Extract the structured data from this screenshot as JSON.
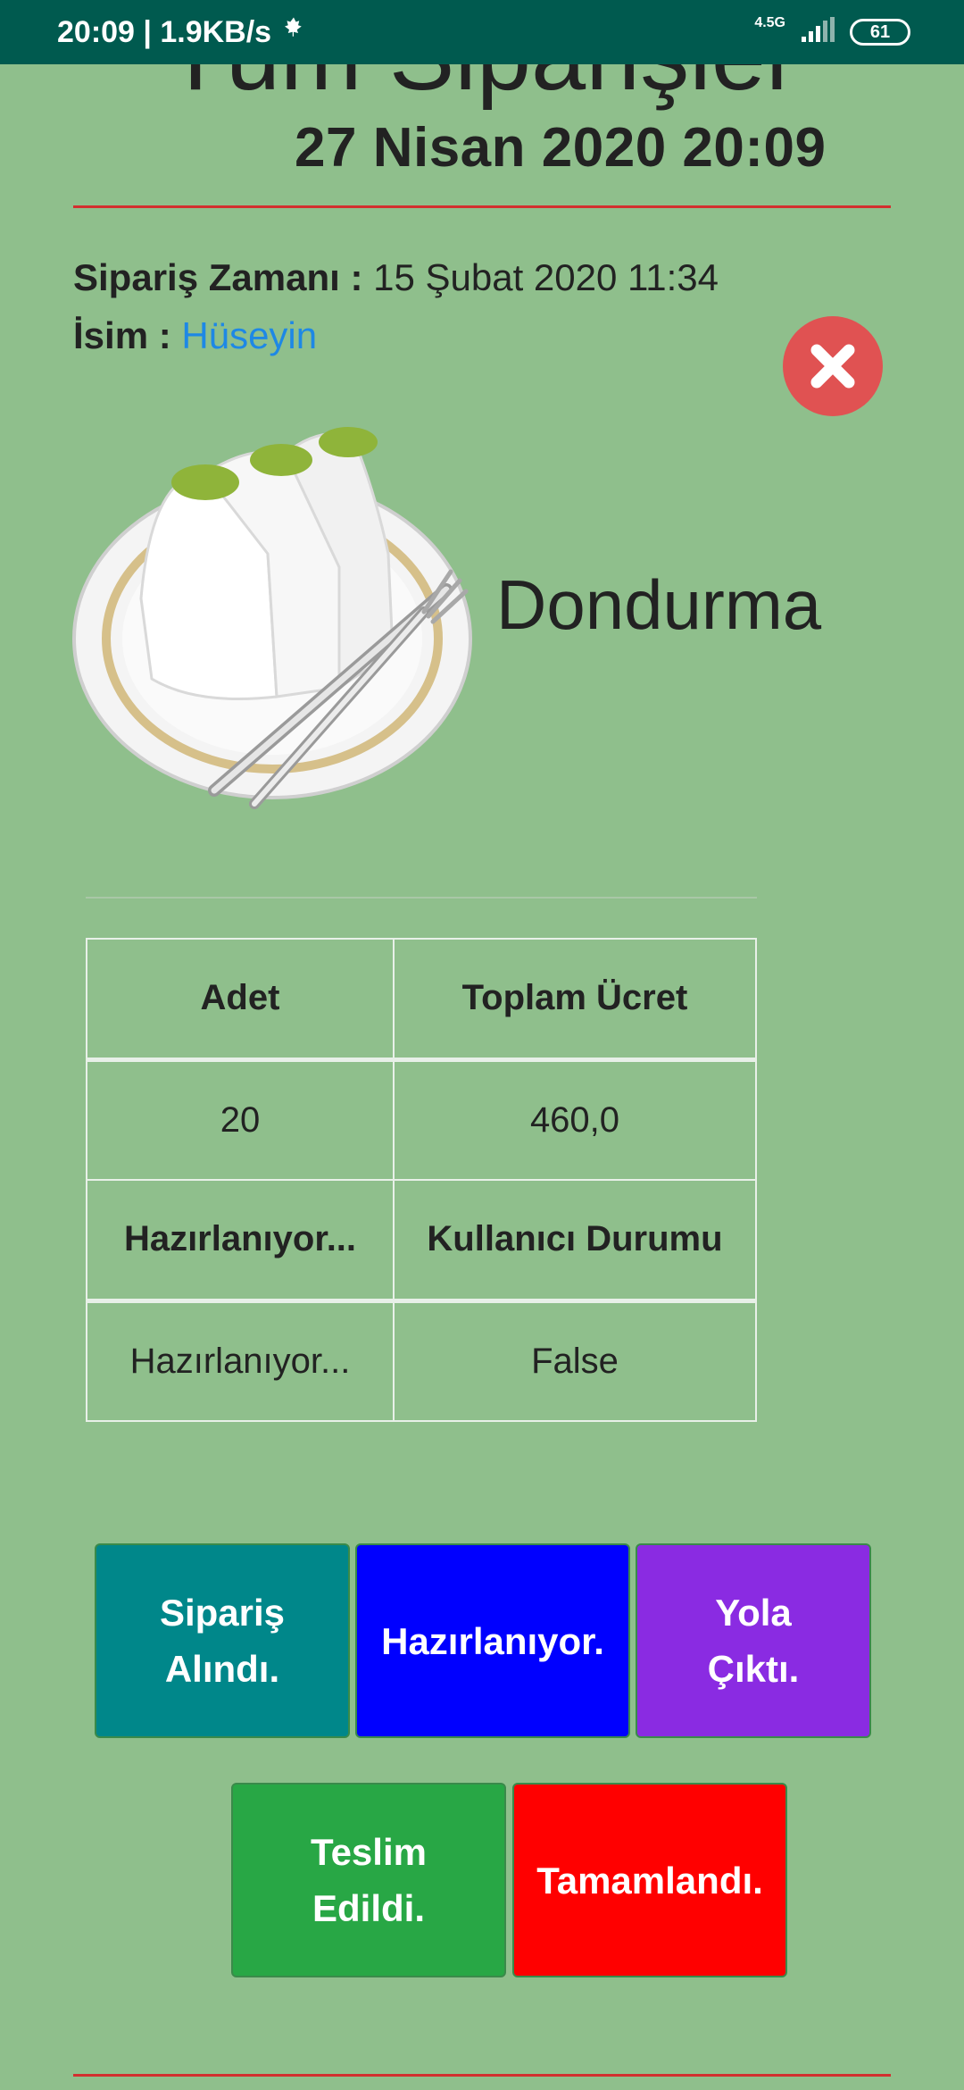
{
  "status_bar": {
    "time_speed": "20:09 | 1.9KB/s",
    "network_type": "4.5G",
    "battery": "61"
  },
  "header": {
    "title": "Tüm Siparişler",
    "datetime": "27 Nisan 2020 20:09"
  },
  "order": {
    "time_label": "Sipariş Zamanı :",
    "time_value": "15 Şubat 2020 11:34",
    "name_label": "İsim :",
    "name_value": "Hüseyin",
    "product_name": "Dondurma"
  },
  "table": {
    "header1": [
      "Adet",
      "Toplam Ücret"
    ],
    "row1": [
      "20",
      "460,0"
    ],
    "header2": [
      "Hazırlanıyor...",
      "Kullanıcı Durumu"
    ],
    "row2": [
      "Hazırlanıyor...",
      "False"
    ]
  },
  "actions": {
    "received": "Sipariş Alındı.",
    "preparing": "Hazırlanıyor.",
    "on_way": "Yola Çıktı.",
    "delivered": "Teslim Edildi.",
    "completed": "Tamamlandı."
  },
  "colors": {
    "background": "#8fbf8c",
    "status_bar": "#005a4f",
    "accent_red": "#d32f2f",
    "received": "#00878a",
    "preparing": "#0000ff",
    "on_way": "#8a2be2",
    "delivered": "#28a745",
    "completed": "#ff0000"
  }
}
